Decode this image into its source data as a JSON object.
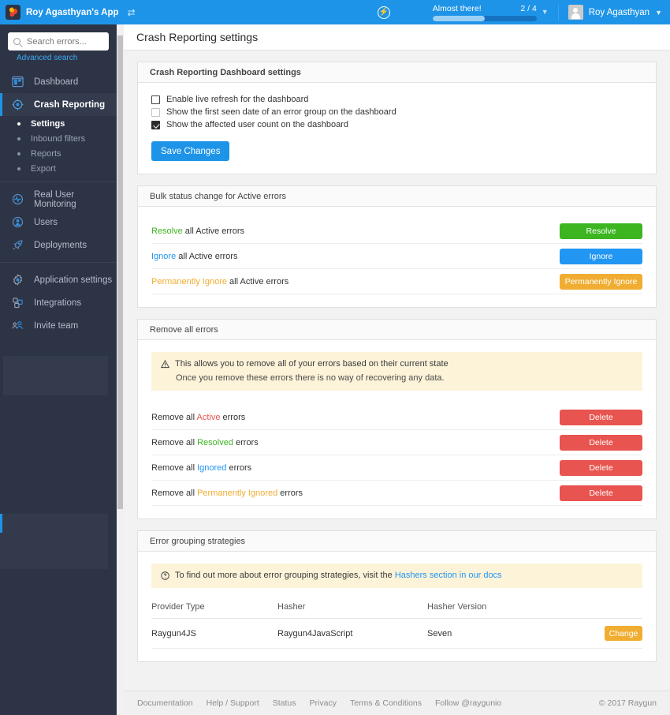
{
  "topbar": {
    "logo_icon": "raygun-logo-icon",
    "app_name": "Roy Agasthyan's App",
    "shuffle_icon": "shuffle-icon",
    "bolt_icon": "bolt-circle-icon",
    "progress": {
      "label": "Almost there!",
      "count": "2 / 4",
      "percent": 50
    },
    "progress_caret": "▼",
    "user_name": "Roy Agasthyan",
    "user_caret": "▼",
    "background_color": "#1e94e8"
  },
  "sidebar": {
    "search": {
      "placeholder": "Search errors...",
      "value": "",
      "icon": "search-icon"
    },
    "advanced_search": "Advanced search",
    "items": [
      {
        "label": "Dashboard",
        "icon": "dashboard-icon",
        "active": false
      },
      {
        "label": "Crash Reporting",
        "icon": "crosshair-icon",
        "active": true
      },
      {
        "label": "Real User Monitoring",
        "icon": "pulse-icon",
        "active": false
      },
      {
        "label": "Users",
        "icon": "user-icon",
        "active": false
      },
      {
        "label": "Deployments",
        "icon": "rocket-icon",
        "active": false
      },
      {
        "label": "Application settings",
        "icon": "gear-icon",
        "active": false
      },
      {
        "label": "Integrations",
        "icon": "puzzle-icon",
        "active": false
      },
      {
        "label": "Invite team",
        "icon": "team-icon",
        "active": false
      }
    ],
    "subitems": [
      {
        "label": "Settings",
        "active": true
      },
      {
        "label": "Inbound filters",
        "active": false
      },
      {
        "label": "Reports",
        "active": false
      },
      {
        "label": "Export",
        "active": false
      }
    ],
    "background_color": "#2d3445"
  },
  "page": {
    "title": "Crash Reporting settings"
  },
  "dashboard_settings": {
    "heading": "Crash Reporting Dashboard settings",
    "checkboxes": [
      {
        "label": "Enable live refresh for the dashboard",
        "checked": false,
        "focused": true
      },
      {
        "label": "Show the first seen date of an error group on the dashboard",
        "checked": false,
        "focused": false
      },
      {
        "label": "Show the affected user count on the dashboard",
        "checked": true,
        "focused": false
      }
    ],
    "save_label": "Save Changes"
  },
  "bulk_status": {
    "heading": "Bulk status change for Active errors",
    "rows": [
      {
        "keyword": "Resolve",
        "rest": " all Active errors",
        "keyword_color": "#3cb521",
        "button": "Resolve",
        "button_color": "#3cb521",
        "kclass": "k-green",
        "bclass": "bg-green"
      },
      {
        "keyword": "Ignore",
        "rest": " all Active errors",
        "keyword_color": "#2196f3",
        "button": "Ignore",
        "button_color": "#2196f3",
        "kclass": "k-blue",
        "bclass": "bg-blue"
      },
      {
        "keyword": "Permanently Ignore",
        "rest": " all Active errors",
        "keyword_color": "#f0ad31",
        "button": "Permanently Ignore",
        "button_color": "#f0ad31",
        "kclass": "k-orange",
        "bclass": "bg-orange"
      }
    ]
  },
  "remove_all": {
    "heading": "Remove all errors",
    "alert_icon": "warning-triangle-icon",
    "alert_line1": "This allows you to remove all of your errors based on their current state",
    "alert_line2": "Once you remove these errors there is no way of recovering any data.",
    "rows": [
      {
        "prefix": "Remove all ",
        "keyword": "Active",
        "suffix": " errors",
        "keyword_color": "#e8544f",
        "kclass": "k-red",
        "button": "Delete"
      },
      {
        "prefix": "Remove all ",
        "keyword": "Resolved",
        "suffix": " errors",
        "keyword_color": "#3cb521",
        "kclass": "k-green",
        "button": "Delete"
      },
      {
        "prefix": "Remove all ",
        "keyword": "Ignored",
        "suffix": " errors",
        "keyword_color": "#2196f3",
        "kclass": "k-blue",
        "button": "Delete"
      },
      {
        "prefix": "Remove all ",
        "keyword": "Permanently Ignored",
        "suffix": " errors",
        "keyword_color": "#f0ad31",
        "kclass": "k-orange",
        "button": "Delete"
      }
    ],
    "delete_color": "#e8544f"
  },
  "grouping": {
    "heading": "Error grouping strategies",
    "info_icon": "question-circle-icon",
    "info_text": "To find out more about error grouping strategies, visit the ",
    "info_link": "Hashers section in our docs",
    "columns": [
      "Provider Type",
      "Hasher",
      "Hasher Version"
    ],
    "rows": [
      {
        "provider": "Raygun4JS",
        "hasher": "Raygun4JavaScript",
        "version": "Seven",
        "action": "Change"
      }
    ],
    "change_color": "#f0ad31"
  },
  "footer": {
    "links": [
      "Documentation",
      "Help / Support",
      "Status",
      "Privacy",
      "Terms & Conditions",
      "Follow @raygunio"
    ],
    "copyright": "© 2017 Raygun"
  }
}
